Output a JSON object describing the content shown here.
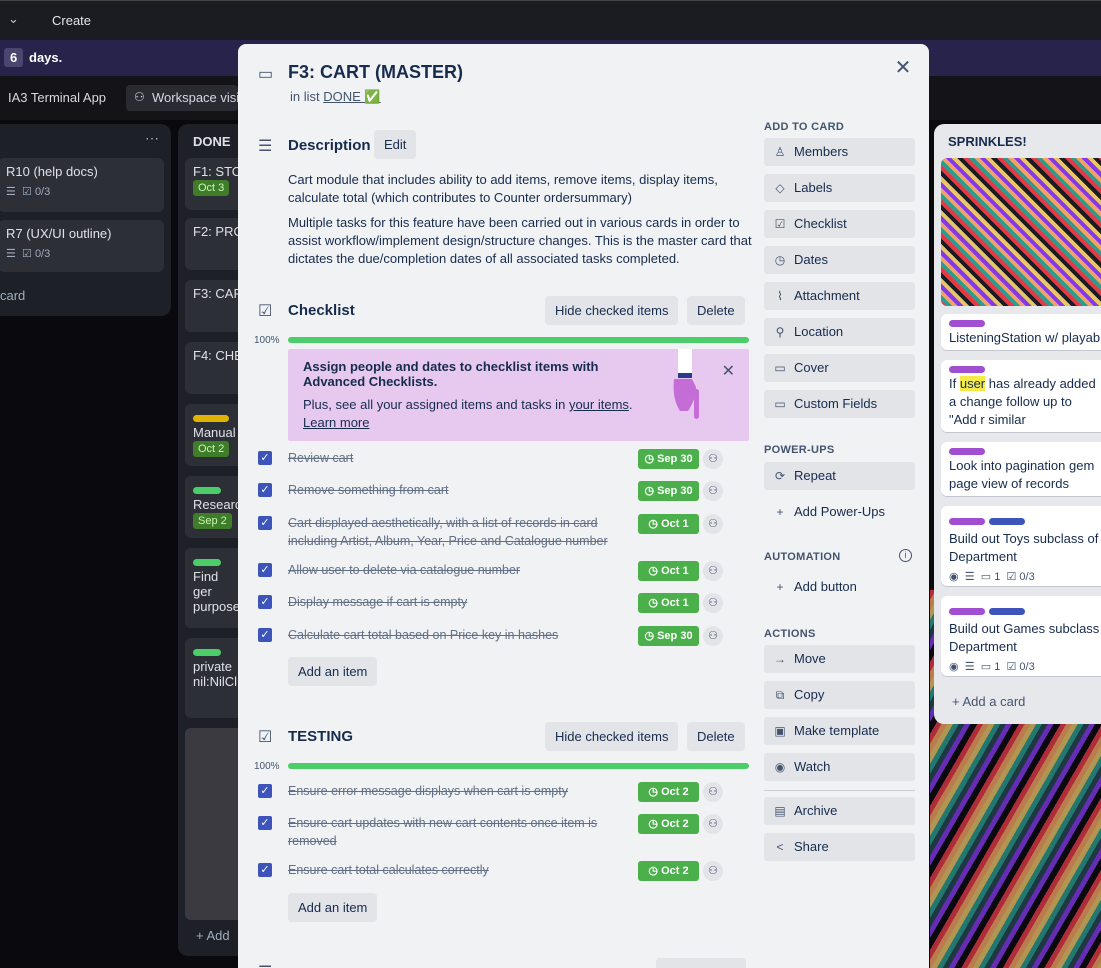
{
  "topbar": {
    "chevron_icon": "chevron-down-icon",
    "create_label": "Create"
  },
  "trial": {
    "number": "6",
    "suffix": "days."
  },
  "boardbar": {
    "pill1": "IA3 Terminal App",
    "pill2": "Workspace visi"
  },
  "left_list": {
    "cards": [
      {
        "title": "R10 (help docs)",
        "checklist": "0/3"
      },
      {
        "title": "R7 (UX/UI outline)",
        "checklist": "0/3"
      }
    ],
    "add_card": "card"
  },
  "done_list": {
    "title": "DONE",
    "cards": [
      {
        "title": "F1: STO",
        "badge": "Oct 3"
      },
      {
        "title": "F2: PRO"
      },
      {
        "title": "F3: CAR"
      },
      {
        "title": "F4: CHE"
      },
      {
        "title": "Manual",
        "badge": "Oct 2"
      },
      {
        "title": "Researc",
        "badge": "Sep 2"
      },
      {
        "title": "Find ger purpose"
      },
      {
        "title": "private nil:NilCl"
      }
    ],
    "add_card": "Add"
  },
  "sprinkles": {
    "title": "SPRINKLES!",
    "cards": [
      {
        "text": "ListeningStation w/ playab"
      },
      {
        "text_before": "If ",
        "highlight": "user",
        "text_after": " has already added a change follow up to \"Add r similar"
      },
      {
        "text": "Look into pagination gem page view of records"
      },
      {
        "text": "Build out Toys subclass of Department",
        "comments": "1",
        "checklist": "0/3"
      },
      {
        "text": "Build out Games subclass Department",
        "comments": "1",
        "checklist": "0/3"
      }
    ],
    "add_card": "Add a card"
  },
  "modal": {
    "title": "F3: CART (MASTER)",
    "in_list_prefix": "in list",
    "list_name": "DONE ✅",
    "close_icon": "close-icon",
    "description": {
      "heading": "Description",
      "edit": "Edit",
      "p1": "Cart module that includes ability to add items, remove items, display items, calculate total (which contributes to Counter ordersummary)",
      "p2": "Multiple tasks for this feature have been carried out in various cards in order to assist workflow/implement design/structure changes. This is the master card that dictates the due/completion dates of all associated tasks completed."
    },
    "checklist": {
      "heading": "Checklist",
      "hide": "Hide checked items",
      "delete": "Delete",
      "percent": "100%",
      "progress": 1.0,
      "items": [
        {
          "text": "Review cart",
          "due": "Sep 30"
        },
        {
          "text": "Remove something from cart",
          "due": "Sep 30"
        },
        {
          "text": "Cart displayed aesthetically, with a list of records in card including Artist, Album, Year, Price and Catalogue number",
          "due": "Oct 1"
        },
        {
          "text": "Allow user to delete via catalogue number",
          "due": "Oct 1"
        },
        {
          "text": "Display message if cart is empty",
          "due": "Oct 1"
        },
        {
          "text": "Calculate cart total based on Price key in hashes",
          "due": "Sep 30"
        }
      ],
      "add_item": "Add an item"
    },
    "promo": {
      "heading": "Assign people and dates to checklist items with Advanced Checklists.",
      "text_prefix": "Plus, see all your assigned items and tasks in",
      "link_items": "your items",
      "text_suffix": ".",
      "learn_more": "Learn more"
    },
    "testing": {
      "heading": "TESTING",
      "hide": "Hide checked items",
      "delete": "Delete",
      "percent": "100%",
      "progress": 1.0,
      "items": [
        {
          "text": "Ensure error message displays when cart is empty",
          "due": "Oct 2"
        },
        {
          "text": "Ensure cart updates with new cart contents once item is removed",
          "due": "Oct 2"
        },
        {
          "text": "Ensure cart total calculates correctly",
          "due": "Oct 2"
        }
      ],
      "add_item": "Add an item"
    },
    "sidebar": {
      "add_to_card": "ADD TO CARD",
      "add_buttons": [
        "Members",
        "Labels",
        "Checklist",
        "Dates",
        "Attachment",
        "Location",
        "Cover",
        "Custom Fields"
      ],
      "powerups_heading": "POWER-UPS",
      "powerups": [
        "Repeat",
        "Add Power-Ups"
      ],
      "automation_heading": "AUTOMATION",
      "automation": [
        "Add button"
      ],
      "actions_heading": "ACTIONS",
      "actions": [
        "Move",
        "Copy",
        "Make template",
        "Watch"
      ],
      "actions2": [
        "Archive",
        "Share"
      ]
    }
  },
  "colors": {
    "accent": "#3d55ba",
    "due_green": "#4bb04b",
    "progress_green": "#4bce6a",
    "promo_bg": "#e7c9f0"
  }
}
